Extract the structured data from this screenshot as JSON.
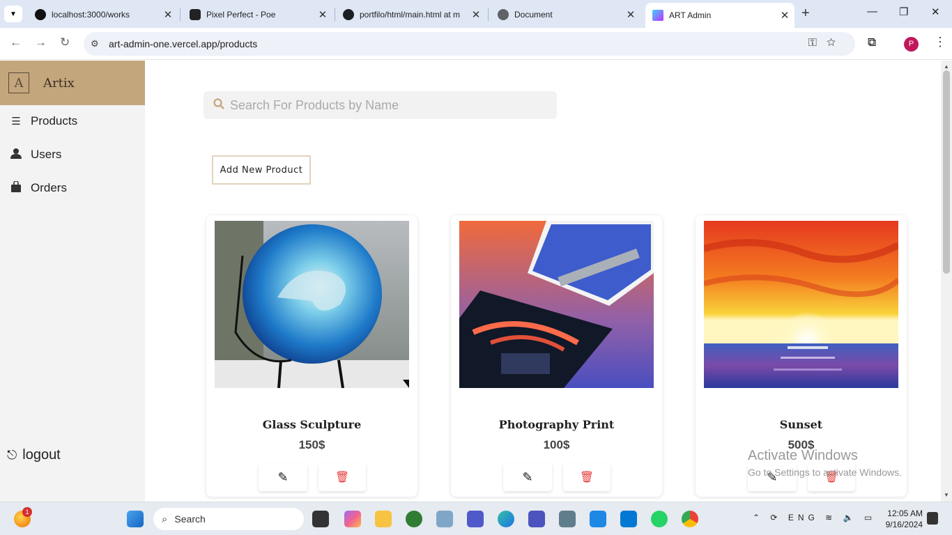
{
  "browser": {
    "tabs": [
      {
        "title": "localhost:3000/works",
        "icon": "vercel-icon"
      },
      {
        "title": "Pixel Perfect - Poe",
        "icon": "poe-icon"
      },
      {
        "title": "portfilo/html/main.html at m",
        "icon": "github-icon"
      },
      {
        "title": "Document",
        "icon": "globe-icon"
      },
      {
        "title": "ART Admin",
        "icon": "vite-icon"
      }
    ],
    "url": "art-admin-one.vercel.app/products",
    "profile_initial": "P"
  },
  "sidebar": {
    "brand_logo": "A",
    "brand_name": "Artix",
    "items": [
      {
        "label": "Products",
        "icon": "list-icon"
      },
      {
        "label": "Users",
        "icon": "user-icon"
      },
      {
        "label": "Orders",
        "icon": "shopping-bag-icon"
      }
    ],
    "logout_label": "logout"
  },
  "main": {
    "search_placeholder": "Search For Products by Name",
    "add_button_label": "Add New Product",
    "products": [
      {
        "name": "Glass Sculpture",
        "price": "150$",
        "image": "glass-wave-sculpture"
      },
      {
        "name": "Photography Print",
        "price": "100$",
        "image": "photo-prints"
      },
      {
        "name": "Sunset",
        "price": "500$",
        "image": "sunset-painting"
      }
    ]
  },
  "watermark": {
    "line1": "Activate Windows",
    "line2": "Go to Settings to activate Windows."
  },
  "taskbar": {
    "search_label": "Search",
    "badge_count": "1",
    "language": "ENG",
    "time": "12:05 AM",
    "date": "9/16/2024"
  },
  "colors": {
    "brand": "#c4a67d",
    "sidebar_bg": "#f3f3f3",
    "delete": "#e53935"
  }
}
